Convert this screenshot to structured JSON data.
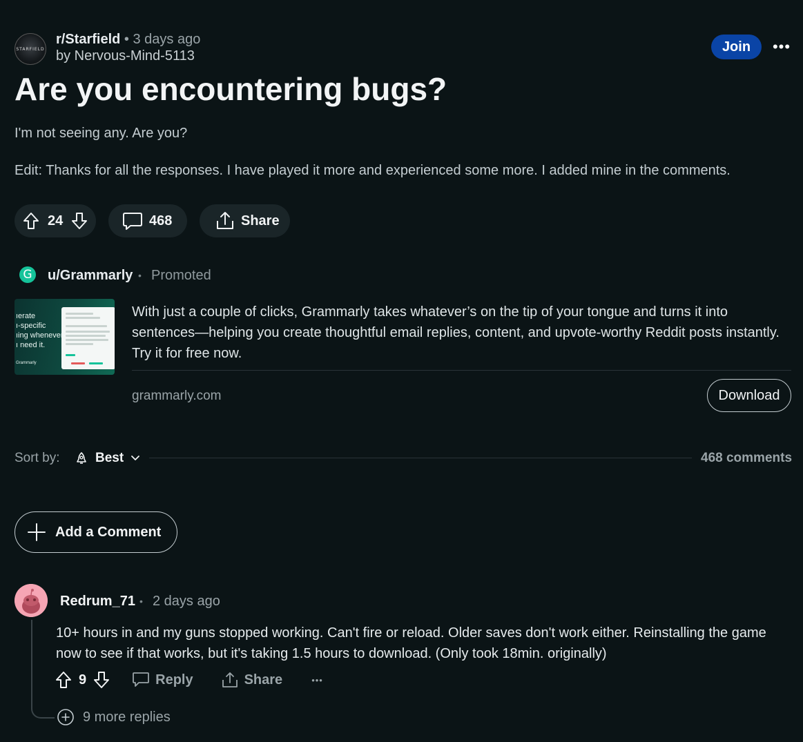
{
  "post": {
    "subreddit": "r/Starfield",
    "separator": "•",
    "time_ago": "3 days ago",
    "by_line": "by Nervous-Mind-5113",
    "subreddit_icon_text": "STARFIELD",
    "join_label": "Join",
    "more_label": "•••",
    "title": "Are you encountering bugs?",
    "body_1": "I'm not seeing any. Are you?",
    "body_2": "Edit: Thanks for all the responses. I have played it more and experienced some more. I added mine in the comments.",
    "upvotes": "24",
    "comments": "468",
    "share_label": "Share"
  },
  "promoted": {
    "user": "u/Grammarly",
    "dot": "•",
    "tag": "Promoted",
    "logo_letter": "G",
    "thumb_lines": [
      "ıerate",
      "ı-specific",
      "ıing whenever",
      "ı need it.",
      "Grammarly"
    ],
    "text": "With just a couple of clicks, Grammarly takes whatever’s on the tip of your tongue and turns it into sentences—helping you create thoughtful email replies, content, and upvote-worthy Reddit posts instantly. Try it for free now.",
    "domain": "grammarly.com",
    "download_label": "Download"
  },
  "sort": {
    "label": "Sort by:",
    "value": "Best",
    "count": "468 comments"
  },
  "add_comment_label": "Add a Comment",
  "comment": {
    "user": "Redrum_71",
    "dot": "•",
    "time_ago": "2 days ago",
    "text": "10+ hours in and my guns stopped working. Can't fire or reload. Older saves don't work either. Reinstalling the game now to see if that works, but it's taking 1.5 hours to download. (Only took 18min. originally)",
    "upvotes": "9",
    "reply_label": "Reply",
    "share_label": "Share",
    "more_label": "•••",
    "more_replies": "9 more replies"
  }
}
